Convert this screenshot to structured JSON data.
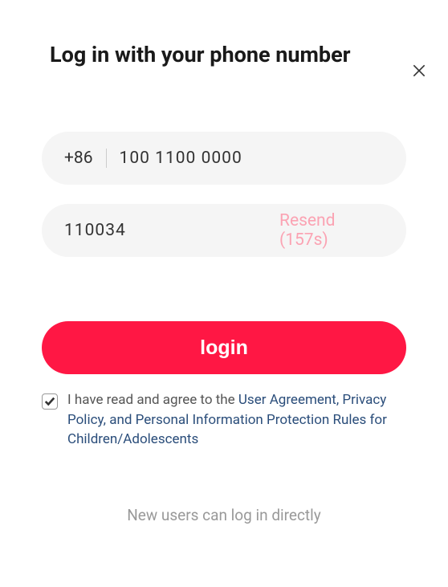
{
  "title": "Log in with your phone number",
  "phone": {
    "country_code": "+86",
    "value": "100 1100 0000"
  },
  "verification": {
    "code": "110034",
    "resend_label": "Resend (157s)"
  },
  "login_button": "login",
  "consent": {
    "checked": true,
    "prefix": "I have read and agree to the ",
    "link_text": "User Agreement, Privacy Policy, and Personal Information Protection Rules for Children/Adolescents"
  },
  "footer": "New users can log in directly"
}
